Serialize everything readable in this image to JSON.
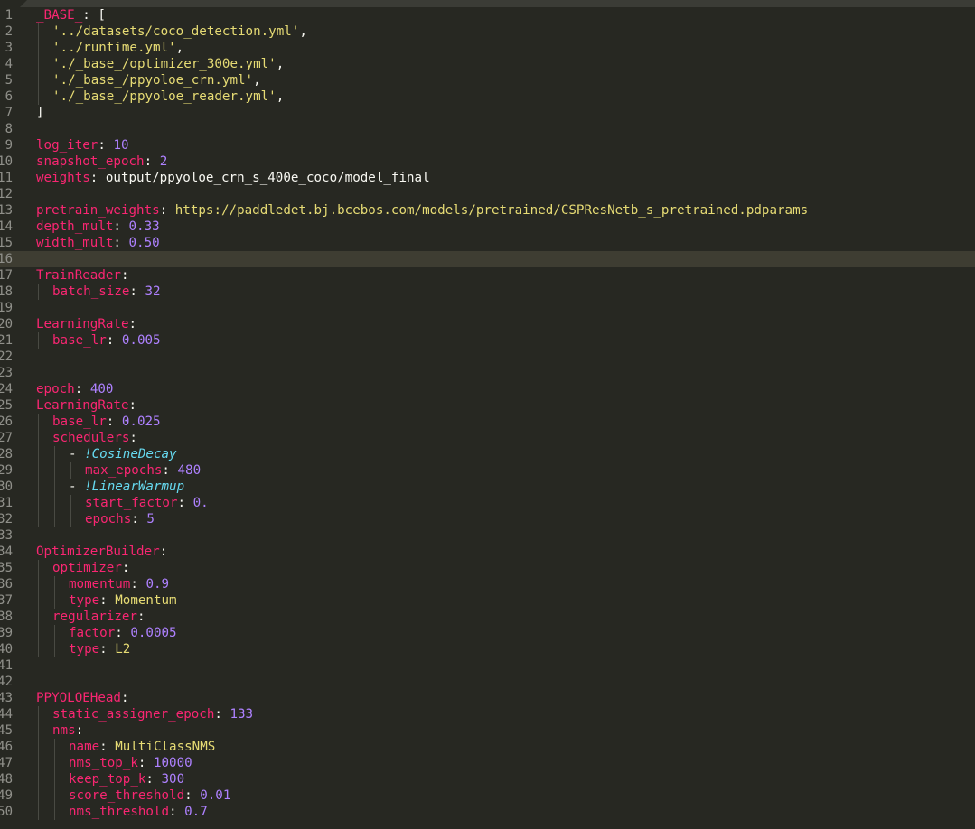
{
  "editor": {
    "colors": {
      "background": "#272822",
      "key": "#f92672",
      "string": "#e6db74",
      "number": "#ae81ff",
      "tag": "#66d9ef",
      "punctuation": "#f8f8f2",
      "line_number": "#90908a",
      "current_line": "#3e3d32"
    },
    "current_line": 16,
    "lines": [
      {
        "n": "1",
        "indent": 0,
        "tokens": [
          {
            "t": "_BASE_",
            "c": "k"
          },
          {
            "t": ": [",
            "c": "p"
          }
        ]
      },
      {
        "n": "2",
        "indent": 1,
        "tokens": [
          {
            "t": "'../datasets/coco_detection.yml'",
            "c": "s"
          },
          {
            "t": ",",
            "c": "p"
          }
        ]
      },
      {
        "n": "3",
        "indent": 1,
        "tokens": [
          {
            "t": "'../runtime.yml'",
            "c": "s"
          },
          {
            "t": ",",
            "c": "p"
          }
        ]
      },
      {
        "n": "4",
        "indent": 1,
        "tokens": [
          {
            "t": "'./_base_/optimizer_300e.yml'",
            "c": "s"
          },
          {
            "t": ",",
            "c": "p"
          }
        ]
      },
      {
        "n": "5",
        "indent": 1,
        "tokens": [
          {
            "t": "'./_base_/ppyoloe_crn.yml'",
            "c": "s"
          },
          {
            "t": ",",
            "c": "p"
          }
        ]
      },
      {
        "n": "6",
        "indent": 1,
        "tokens": [
          {
            "t": "'./_base_/ppyoloe_reader.yml'",
            "c": "s"
          },
          {
            "t": ",",
            "c": "p"
          }
        ]
      },
      {
        "n": "7",
        "indent": 0,
        "tokens": [
          {
            "t": "]",
            "c": "p"
          }
        ]
      },
      {
        "n": "8",
        "indent": 0,
        "tokens": []
      },
      {
        "n": "9",
        "indent": 0,
        "tokens": [
          {
            "t": "log_iter",
            "c": "k"
          },
          {
            "t": ": ",
            "c": "p"
          },
          {
            "t": "10",
            "c": "n"
          }
        ]
      },
      {
        "n": "10",
        "indent": 0,
        "tokens": [
          {
            "t": "snapshot_epoch",
            "c": "k"
          },
          {
            "t": ": ",
            "c": "p"
          },
          {
            "t": "2",
            "c": "n"
          }
        ]
      },
      {
        "n": "11",
        "indent": 0,
        "tokens": [
          {
            "t": "weights",
            "c": "k"
          },
          {
            "t": ": output/ppyoloe_crn_s_400e_coco/model_final",
            "c": "p"
          }
        ]
      },
      {
        "n": "12",
        "indent": 0,
        "tokens": []
      },
      {
        "n": "13",
        "indent": 0,
        "tokens": [
          {
            "t": "pretrain_weights",
            "c": "k"
          },
          {
            "t": ": ",
            "c": "p"
          },
          {
            "t": "https://paddledet.bj.bcebos.com/models/pretrained/CSPResNetb_s_pretrained.pdparams",
            "c": "s"
          }
        ]
      },
      {
        "n": "14",
        "indent": 0,
        "tokens": [
          {
            "t": "depth_mult",
            "c": "k"
          },
          {
            "t": ": ",
            "c": "p"
          },
          {
            "t": "0.33",
            "c": "n"
          }
        ]
      },
      {
        "n": "15",
        "indent": 0,
        "tokens": [
          {
            "t": "width_mult",
            "c": "k"
          },
          {
            "t": ": ",
            "c": "p"
          },
          {
            "t": "0.50",
            "c": "n"
          }
        ]
      },
      {
        "n": "16",
        "indent": 0,
        "tokens": []
      },
      {
        "n": "17",
        "indent": 0,
        "tokens": [
          {
            "t": "TrainReader",
            "c": "k"
          },
          {
            "t": ":",
            "c": "p"
          }
        ]
      },
      {
        "n": "18",
        "indent": 1,
        "tokens": [
          {
            "t": "batch_size",
            "c": "k"
          },
          {
            "t": ": ",
            "c": "p"
          },
          {
            "t": "32",
            "c": "n"
          }
        ]
      },
      {
        "n": "19",
        "indent": 0,
        "tokens": []
      },
      {
        "n": "20",
        "indent": 0,
        "tokens": [
          {
            "t": "LearningRate",
            "c": "k"
          },
          {
            "t": ":",
            "c": "p"
          }
        ]
      },
      {
        "n": "21",
        "indent": 1,
        "tokens": [
          {
            "t": "base_lr",
            "c": "k"
          },
          {
            "t": ": ",
            "c": "p"
          },
          {
            "t": "0.005",
            "c": "n"
          }
        ]
      },
      {
        "n": "22",
        "indent": 0,
        "tokens": []
      },
      {
        "n": "23",
        "indent": 0,
        "tokens": []
      },
      {
        "n": "24",
        "indent": 0,
        "tokens": [
          {
            "t": "epoch",
            "c": "k"
          },
          {
            "t": ": ",
            "c": "p"
          },
          {
            "t": "400",
            "c": "n"
          }
        ]
      },
      {
        "n": "25",
        "indent": 0,
        "tokens": [
          {
            "t": "LearningRate",
            "c": "k"
          },
          {
            "t": ":",
            "c": "p"
          }
        ]
      },
      {
        "n": "26",
        "indent": 1,
        "tokens": [
          {
            "t": "base_lr",
            "c": "k"
          },
          {
            "t": ": ",
            "c": "p"
          },
          {
            "t": "0.025",
            "c": "n"
          }
        ]
      },
      {
        "n": "27",
        "indent": 1,
        "tokens": [
          {
            "t": "schedulers",
            "c": "k"
          },
          {
            "t": ":",
            "c": "p"
          }
        ]
      },
      {
        "n": "28",
        "indent": 2,
        "tokens": [
          {
            "t": "- ",
            "c": "p"
          },
          {
            "t": "!CosineDecay",
            "c": "t"
          }
        ]
      },
      {
        "n": "29",
        "indent": 3,
        "tokens": [
          {
            "t": "max_epochs",
            "c": "k"
          },
          {
            "t": ": ",
            "c": "p"
          },
          {
            "t": "480",
            "c": "n"
          }
        ]
      },
      {
        "n": "30",
        "indent": 2,
        "tokens": [
          {
            "t": "- ",
            "c": "p"
          },
          {
            "t": "!LinearWarmup",
            "c": "t"
          }
        ]
      },
      {
        "n": "31",
        "indent": 3,
        "tokens": [
          {
            "t": "start_factor",
            "c": "k"
          },
          {
            "t": ": ",
            "c": "p"
          },
          {
            "t": "0.",
            "c": "n"
          }
        ]
      },
      {
        "n": "32",
        "indent": 3,
        "tokens": [
          {
            "t": "epochs",
            "c": "k"
          },
          {
            "t": ": ",
            "c": "p"
          },
          {
            "t": "5",
            "c": "n"
          }
        ]
      },
      {
        "n": "33",
        "indent": 0,
        "tokens": []
      },
      {
        "n": "34",
        "indent": 0,
        "tokens": [
          {
            "t": "OptimizerBuilder",
            "c": "k"
          },
          {
            "t": ":",
            "c": "p"
          }
        ]
      },
      {
        "n": "35",
        "indent": 1,
        "tokens": [
          {
            "t": "optimizer",
            "c": "k"
          },
          {
            "t": ":",
            "c": "p"
          }
        ]
      },
      {
        "n": "36",
        "indent": 2,
        "tokens": [
          {
            "t": "momentum",
            "c": "k"
          },
          {
            "t": ": ",
            "c": "p"
          },
          {
            "t": "0.9",
            "c": "n"
          }
        ]
      },
      {
        "n": "37",
        "indent": 2,
        "tokens": [
          {
            "t": "type",
            "c": "k"
          },
          {
            "t": ": ",
            "c": "p"
          },
          {
            "t": "Momentum",
            "c": "s"
          }
        ]
      },
      {
        "n": "38",
        "indent": 1,
        "tokens": [
          {
            "t": "regularizer",
            "c": "k"
          },
          {
            "t": ":",
            "c": "p"
          }
        ]
      },
      {
        "n": "39",
        "indent": 2,
        "tokens": [
          {
            "t": "factor",
            "c": "k"
          },
          {
            "t": ": ",
            "c": "p"
          },
          {
            "t": "0.0005",
            "c": "n"
          }
        ]
      },
      {
        "n": "40",
        "indent": 2,
        "tokens": [
          {
            "t": "type",
            "c": "k"
          },
          {
            "t": ": ",
            "c": "p"
          },
          {
            "t": "L2",
            "c": "s"
          }
        ]
      },
      {
        "n": "41",
        "indent": 0,
        "tokens": []
      },
      {
        "n": "42",
        "indent": 0,
        "tokens": []
      },
      {
        "n": "43",
        "indent": 0,
        "tokens": [
          {
            "t": "PPYOLOEHead",
            "c": "k"
          },
          {
            "t": ":",
            "c": "p"
          }
        ]
      },
      {
        "n": "44",
        "indent": 1,
        "tokens": [
          {
            "t": "static_assigner_epoch",
            "c": "k"
          },
          {
            "t": ": ",
            "c": "p"
          },
          {
            "t": "133",
            "c": "n"
          }
        ]
      },
      {
        "n": "45",
        "indent": 1,
        "tokens": [
          {
            "t": "nms",
            "c": "k"
          },
          {
            "t": ":",
            "c": "p"
          }
        ]
      },
      {
        "n": "46",
        "indent": 2,
        "tokens": [
          {
            "t": "name",
            "c": "k"
          },
          {
            "t": ": ",
            "c": "p"
          },
          {
            "t": "MultiClassNMS",
            "c": "s"
          }
        ]
      },
      {
        "n": "47",
        "indent": 2,
        "tokens": [
          {
            "t": "nms_top_k",
            "c": "k"
          },
          {
            "t": ": ",
            "c": "p"
          },
          {
            "t": "10000",
            "c": "n"
          }
        ]
      },
      {
        "n": "48",
        "indent": 2,
        "tokens": [
          {
            "t": "keep_top_k",
            "c": "k"
          },
          {
            "t": ": ",
            "c": "p"
          },
          {
            "t": "300",
            "c": "n"
          }
        ]
      },
      {
        "n": "49",
        "indent": 2,
        "tokens": [
          {
            "t": "score_threshold",
            "c": "k"
          },
          {
            "t": ": ",
            "c": "p"
          },
          {
            "t": "0.01",
            "c": "n"
          }
        ]
      },
      {
        "n": "50",
        "indent": 2,
        "tokens": [
          {
            "t": "nms_threshold",
            "c": "k"
          },
          {
            "t": ": ",
            "c": "p"
          },
          {
            "t": "0.7",
            "c": "n"
          }
        ]
      }
    ]
  }
}
